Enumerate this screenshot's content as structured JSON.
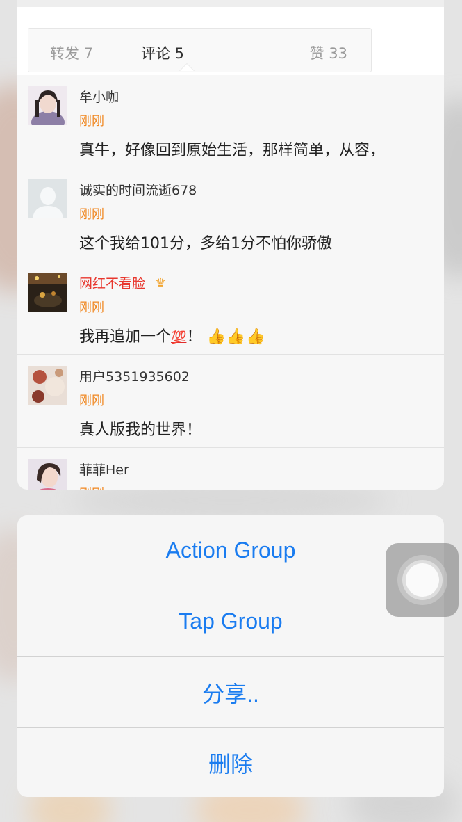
{
  "tabs": {
    "repost": "转发 7",
    "comment": "评论 5",
    "like": "赞 33"
  },
  "comments": [
    {
      "username": "牟小咖",
      "time": "刚刚",
      "text": "真牛，好像回到原始生活，那样简单，从容，",
      "avatar": "avatar-photo"
    },
    {
      "username": "诚实的时间流逝678",
      "time": "刚刚",
      "text": "这个我给101分，多给1分不怕你骄傲",
      "avatar": "default-avatar-icon"
    },
    {
      "username": "网红不看脸",
      "time": "刚刚",
      "text_before": "我再追加一个",
      "emoji_hundred": "💯",
      "text_after": "！",
      "emoji_thumbs": "👍👍👍",
      "avatar": "avatar-photo",
      "badge": "crown-icon"
    },
    {
      "username": "用户5351935602",
      "time": "刚刚",
      "text": "真人版我的世界！",
      "avatar": "avatar-photo"
    },
    {
      "username": "菲菲Her",
      "time": "刚刚",
      "text": "",
      "avatar": "avatar-photo"
    }
  ],
  "action_sheet": {
    "items": [
      "Action Group",
      "Tap Group",
      "分享..",
      "删除"
    ],
    "accent_color": "#1a7cf0"
  },
  "colors": {
    "username_vip": "#e8372e",
    "timestamp": "#f0861e"
  }
}
